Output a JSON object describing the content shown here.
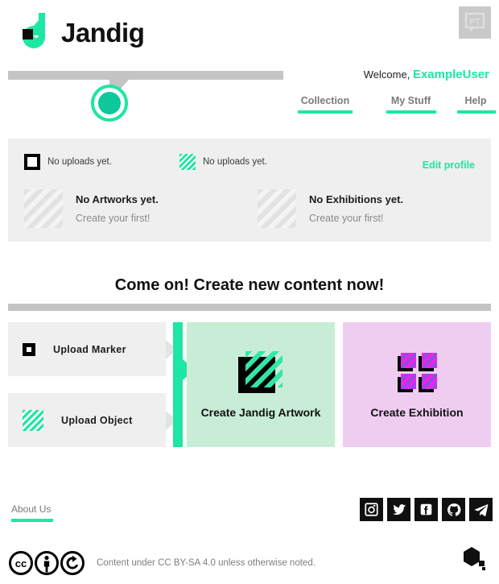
{
  "header": {
    "logo_text": "Jandig",
    "logo_icon": "jandig-j-logo",
    "language_badge": {
      "label": "PT",
      "icon": "speech-bubble-icon"
    }
  },
  "welcome": {
    "prefix": "Welcome,",
    "username": "ExampleUser"
  },
  "nav": {
    "items": [
      {
        "label": "Collection",
        "name": "nav-collection"
      },
      {
        "label": "My Stuff",
        "name": "nav-my-stuff"
      },
      {
        "label": "Help",
        "name": "nav-help"
      }
    ]
  },
  "profile": {
    "stats": [
      {
        "icon": "marker-square-icon",
        "text": "No uploads yet."
      },
      {
        "icon": "object-striped-icon",
        "text": "No uploads yet."
      }
    ],
    "edit_label": "Edit profile",
    "empties": [
      {
        "icon": "artwork-placeholder-icon",
        "title": "No Artworks yet.",
        "subtitle": "Create your first!"
      },
      {
        "icon": "exhibition-placeholder-icon",
        "title": "No Exhibitions yet.",
        "subtitle": "Create your first!"
      }
    ]
  },
  "cta": {
    "heading": "Come on! Create new content now!"
  },
  "actions": {
    "uploads": [
      {
        "icon": "marker-square-icon",
        "label": "Upload Marker"
      },
      {
        "icon": "object-striped-icon",
        "label": "Upload Object"
      }
    ],
    "cards": [
      {
        "icon": "jandig-artwork-icon",
        "label": "Create Jandig Artwork",
        "color": "#c8edd6"
      },
      {
        "icon": "exhibition-grid-icon",
        "label": "Create Exhibition",
        "color": "#efcdf0"
      }
    ]
  },
  "footer": {
    "about_label": "About Us",
    "socials": [
      {
        "name": "instagram-icon",
        "label": "Instagram"
      },
      {
        "name": "twitter-icon",
        "label": "Twitter"
      },
      {
        "name": "facebook-icon",
        "label": "Facebook"
      },
      {
        "name": "github-icon",
        "label": "GitHub"
      },
      {
        "name": "telegram-icon",
        "label": "Telegram"
      }
    ],
    "license_icons": [
      "cc-icon",
      "cc-by-icon",
      "cc-sa-icon"
    ],
    "license_text": "Content under CC BY-SA 4.0 unless otherwise noted.",
    "brand_mark": "hexagon-brand-icon"
  },
  "colors": {
    "accent": "#1ee6a4",
    "accent_dark": "#0ec79b",
    "card_gray": "#efefef",
    "bar_gray": "#c4c4c4",
    "artwork_card": "#c8edd6",
    "exhibition_card": "#efcdf0",
    "magenta": "#f21ff2"
  }
}
